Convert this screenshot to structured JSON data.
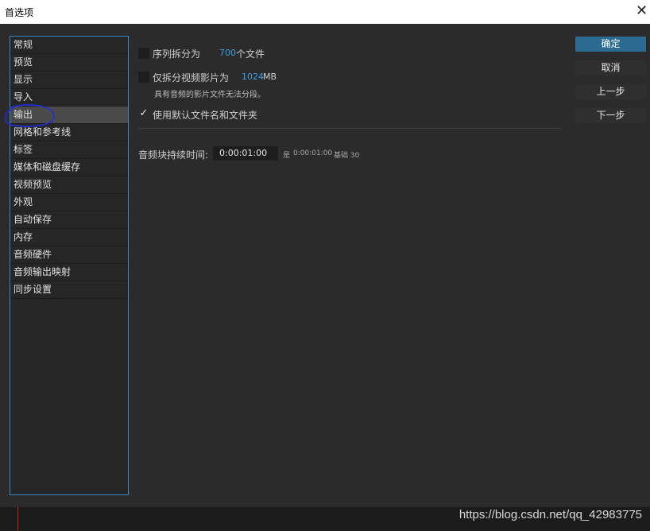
{
  "window": {
    "title": "首选项",
    "close_glyph": "✕"
  },
  "sidebar": {
    "items": [
      {
        "label": "常规"
      },
      {
        "label": "预览"
      },
      {
        "label": "显示"
      },
      {
        "label": "导入"
      },
      {
        "label": "输出"
      },
      {
        "label": "网格和参考线"
      },
      {
        "label": "标签"
      },
      {
        "label": "媒体和磁盘缓存"
      },
      {
        "label": "视频预览"
      },
      {
        "label": "外观"
      },
      {
        "label": "自动保存"
      },
      {
        "label": "内存"
      },
      {
        "label": "音频硬件"
      },
      {
        "label": "音频输出映射"
      },
      {
        "label": "同步设置"
      }
    ],
    "active": "输出"
  },
  "options": {
    "split_sequence": {
      "label": "序列拆分为",
      "value": "700",
      "unit": "个文件",
      "checked": false
    },
    "split_video_only": {
      "label": "仅拆分视频影片为",
      "value": "1024",
      "unit": "MB",
      "note": "具有音频的影片文件无法分段。",
      "checked": false
    },
    "use_default_names": {
      "label": "使用默认文件名和文件夹",
      "checked": true,
      "check_glyph": "✓"
    }
  },
  "audio_block": {
    "label": "音频块持续时间:",
    "value": "0:00:01:00",
    "suffix_is": "是",
    "suffix_value": "0:00:01:00",
    "suffix_base": "基础 30"
  },
  "buttons": {
    "ok": "确定",
    "cancel": "取消",
    "prev": "上一步",
    "next": "下一步"
  },
  "colors": {
    "accent": "#3a86c1",
    "value_blue": "#3aa0e3",
    "primary_button": "#2b6b91",
    "annotation_circle": "#1f2fe0"
  },
  "watermark": "https://blog.csdn.net/qq_42983775"
}
